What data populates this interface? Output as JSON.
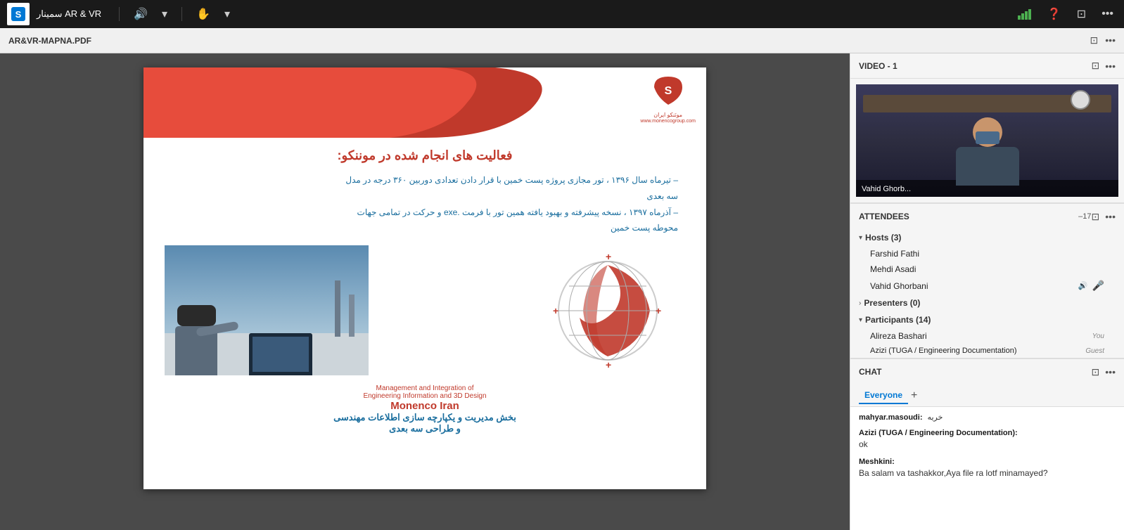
{
  "topbar": {
    "logo_text": "S",
    "app_title": "سمینار AR & VR",
    "sound_icon": "🔊",
    "chevron_down": "▾",
    "hand_icon": "✋",
    "chevron_down2": "▾",
    "signal_icon": "📶",
    "help_icon": "❓",
    "window_icon": "⊡",
    "more_icon": "•••"
  },
  "secondbar": {
    "file_title": "AR&VR-MAPNA.PDF",
    "screen_icon": "⊡",
    "more_icon": "•••"
  },
  "pdf": {
    "logo_letter": "S",
    "company_name": "مونَنکو ایران",
    "company_url": "www.monencogroup.com",
    "title": "فعالیت های انجام شده در موننکو:",
    "line1": "– تیرماه سال ۱۳۹۶ ، تور مجازی پروژه پست خمین با قرار دادن تعدادی دوربین ۳۶۰ درجه در مدل",
    "line2": "سه بعدی",
    "line3": "– آذرماه ۱۳۹۷ ، نسخه پیشرفته و بهبود یافته همین تور با فرمت .exe و حرکت در تمامی جهات",
    "line4": "محوطه پست خمین",
    "footer_en1": "Management and Integration of",
    "footer_en2": "Engineering Information and 3D Design",
    "footer_bold": "Monenco Iran",
    "footer_persian1": "بخش مدیریت و یکپارچه سازی اطلاعات مهندسی",
    "footer_persian2": "و طراحی سه بعدی"
  },
  "video_section": {
    "title": "VIDEO - 1",
    "screen_icon": "⊡",
    "more_icon": "•••",
    "person_name": "Vahid Ghorb..."
  },
  "attendees_section": {
    "title": "ATTENDEES",
    "count": "17",
    "screen_icon": "⊡",
    "more_icon": "•••",
    "hosts_group": {
      "label": "Hosts (3)",
      "expanded": true,
      "members": [
        {
          "name": "Farshid Fathi",
          "badge": "",
          "mic": false
        },
        {
          "name": "Mehdi Asadi",
          "badge": "",
          "mic": false
        },
        {
          "name": "Vahid Ghorbani",
          "badge": "",
          "mic": true,
          "speaking": true
        }
      ]
    },
    "presenters_group": {
      "label": "Presenters (0)",
      "expanded": false,
      "members": []
    },
    "participants_group": {
      "label": "Participants (14)",
      "expanded": true,
      "members": [
        {
          "name": "Alireza Bashari",
          "badge": "You",
          "mic": false
        },
        {
          "name": "Azizi (TUGA / Engineering Documentation)",
          "badge": "Guest",
          "mic": false
        },
        {
          "name": "...",
          "badge": "",
          "mic": false
        }
      ]
    }
  },
  "chat_section": {
    "title": "CHAT",
    "screen_icon": "⊡",
    "more_icon": "•••",
    "tab_everyone": "Everyone",
    "plus_btn": "+",
    "messages": [
      {
        "sender": "mahyar.masoudi:",
        "arabic": "خریه",
        "text": ""
      },
      {
        "sender": "Azizi (TUGA / Engineering Documentation):",
        "arabic": "",
        "text": "ok"
      },
      {
        "sender": "Meshkini:",
        "arabic": "",
        "text": "Ba salam va tashakkor,Aya file ra lotf minamayed?"
      }
    ]
  }
}
